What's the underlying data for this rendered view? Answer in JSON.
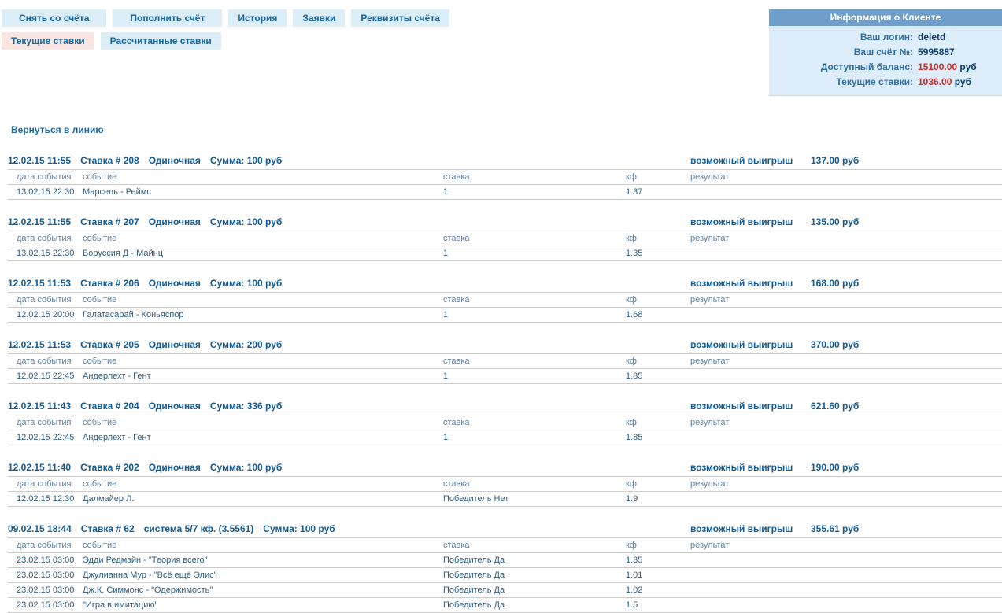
{
  "colors": {
    "accent_blue": "#1565a0",
    "header_navy": "#155a93",
    "alert_red": "#cc2b2b",
    "panel_header_bg": "#6e9ec9",
    "panel_body_bg": "#ddeefa",
    "tab_bg": "#dbedf7",
    "tab_active_bg": "#f9e5e2"
  },
  "nav": {
    "row1": [
      "Снять со счёта",
      "Пополнить счёт",
      "История",
      "Заявки",
      "Реквизиты счёта"
    ],
    "row2": [
      {
        "label": "Текущие ставки",
        "active": true
      },
      {
        "label": "Рассчитанные ставки",
        "active": false
      }
    ]
  },
  "client_info": {
    "title": "Информация о Клиенте",
    "rows": [
      {
        "label": "Ваш логин:",
        "value": "deletd",
        "suffix": "",
        "highlight": false
      },
      {
        "label": "Ваш счёт №:",
        "value": "5995887",
        "suffix": "",
        "highlight": false
      },
      {
        "label": "Доступный баланс:",
        "value": "15100.00",
        "suffix": " руб",
        "highlight": true
      },
      {
        "label": "Текущие ставки:",
        "value": "1036.00",
        "suffix": " руб",
        "highlight": true
      }
    ]
  },
  "back_link_label": "Вернуться в линию",
  "labels": {
    "possible_win": "возможный выигрыш"
  },
  "table_headers": {
    "date": "дата события",
    "event": "событие",
    "stake": "ставка",
    "coef": "кф",
    "result": "результат"
  },
  "bets": [
    {
      "placed": "12.02.15 11:55",
      "number": "Ставка # 208",
      "type": "Одиночная",
      "sum": "Сумма: 100 руб",
      "win": "137.00 руб",
      "rows": [
        {
          "date": "13.02.15 22:30",
          "event": "Марсель - Реймс",
          "stake": "1",
          "coef": "1.37",
          "result": ""
        }
      ]
    },
    {
      "placed": "12.02.15 11:55",
      "number": "Ставка # 207",
      "type": "Одиночная",
      "sum": "Сумма: 100 руб",
      "win": "135.00 руб",
      "rows": [
        {
          "date": "13.02.15 22:30",
          "event": "Боруссия Д - Майнц",
          "stake": "1",
          "coef": "1.35",
          "result": ""
        }
      ]
    },
    {
      "placed": "12.02.15 11:53",
      "number": "Ставка # 206",
      "type": "Одиночная",
      "sum": "Сумма: 100 руб",
      "win": "168.00 руб",
      "rows": [
        {
          "date": "12.02.15 20:00",
          "event": "Галатасарай - Коньяспор",
          "stake": "1",
          "coef": "1.68",
          "result": ""
        }
      ]
    },
    {
      "placed": "12.02.15 11:53",
      "number": "Ставка # 205",
      "type": "Одиночная",
      "sum": "Сумма: 200 руб",
      "win": "370.00 руб",
      "rows": [
        {
          "date": "12.02.15 22:45",
          "event": "Андерлехт - Гент",
          "stake": "1",
          "coef": "1.85",
          "result": ""
        }
      ]
    },
    {
      "placed": "12.02.15 11:43",
      "number": "Ставка # 204",
      "type": "Одиночная",
      "sum": "Сумма: 336 руб",
      "win": "621.60 руб",
      "rows": [
        {
          "date": "12.02.15 22:45",
          "event": "Андерлехт - Гент",
          "stake": "1",
          "coef": "1.85",
          "result": ""
        }
      ]
    },
    {
      "placed": "12.02.15 11:40",
      "number": "Ставка # 202",
      "type": "Одиночная",
      "sum": "Сумма: 100 руб",
      "win": "190.00 руб",
      "rows": [
        {
          "date": "12.02.15 12:30",
          "event": "Далмайер Л.",
          "stake": "Победитель Нет",
          "coef": "1.9",
          "result": ""
        }
      ]
    },
    {
      "placed": "09.02.15 18:44",
      "number": "Ставка # 62",
      "type": "система 5/7 кф. (3.5561)",
      "sum": "Сумма: 100 руб",
      "win": "355.61 руб",
      "rows": [
        {
          "date": "23.02.15 03:00",
          "event": "Эдди Редмэйн - \"Теория всего\"",
          "stake": "Победитель Да",
          "coef": "1.35",
          "result": ""
        },
        {
          "date": "23.02.15 03:00",
          "event": "Джулианна Мур - \"Всё ещё Элис\"",
          "stake": "Победитель Да",
          "coef": "1.01",
          "result": ""
        },
        {
          "date": "23.02.15 03:00",
          "event": "Дж.К. Симмонс - \"Одержимость\"",
          "stake": "Победитель Да",
          "coef": "1.02",
          "result": ""
        },
        {
          "date": "23.02.15 03:00",
          "event": "\"Игра в имитацию\"",
          "stake": "Победитель Да",
          "coef": "1.5",
          "result": ""
        }
      ]
    }
  ]
}
